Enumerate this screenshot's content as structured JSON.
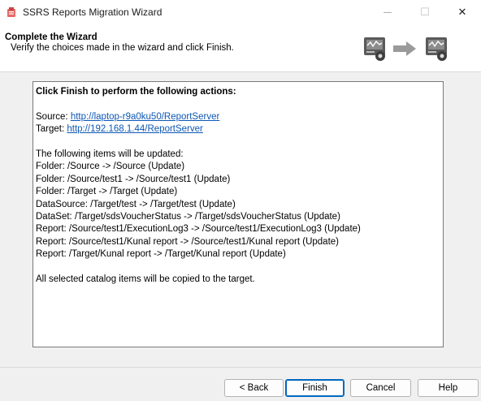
{
  "window": {
    "title": "SSRS Reports Migration Wizard",
    "minimize_glyph": "—",
    "maximize_glyph": "☐",
    "close_glyph": "✕"
  },
  "header": {
    "title": "Complete the Wizard",
    "subtitle": "Verify the choices made in the wizard and click Finish.",
    "graphic_icons": [
      "server-icon",
      "arrow-right-icon",
      "server-icon"
    ]
  },
  "summary": {
    "heading": "Click Finish to perform the following actions:",
    "source_label": "Source: ",
    "source_url": "http://laptop-r9a0ku50/ReportServer",
    "target_label": "Target: ",
    "target_url": "http://192.168.1.44/ReportServer",
    "items_intro": "The following items will be updated:",
    "items": [
      "Folder: /Source -> /Source (Update)",
      "Folder: /Source/test1 -> /Source/test1 (Update)",
      "Folder: /Target -> /Target (Update)",
      "DataSource: /Target/test -> /Target/test (Update)",
      "DataSet: /Target/sdsVoucherStatus -> /Target/sdsVoucherStatus (Update)",
      "Report: /Source/test1/ExecutionLog3 -> /Source/test1/ExecutionLog3 (Update)",
      "Report: /Source/test1/Kunal report -> /Source/test1/Kunal report (Update)",
      "Report: /Target/Kunal report -> /Target/Kunal report (Update)"
    ],
    "footer_note": "All selected catalog items will be copied to the target."
  },
  "buttons": {
    "back": "< Back",
    "finish": "Finish",
    "cancel": "Cancel",
    "help": "Help"
  },
  "colors": {
    "link": "#0c57b5",
    "default_button_border": "#0067c0",
    "app_icon": "#d9534f"
  }
}
